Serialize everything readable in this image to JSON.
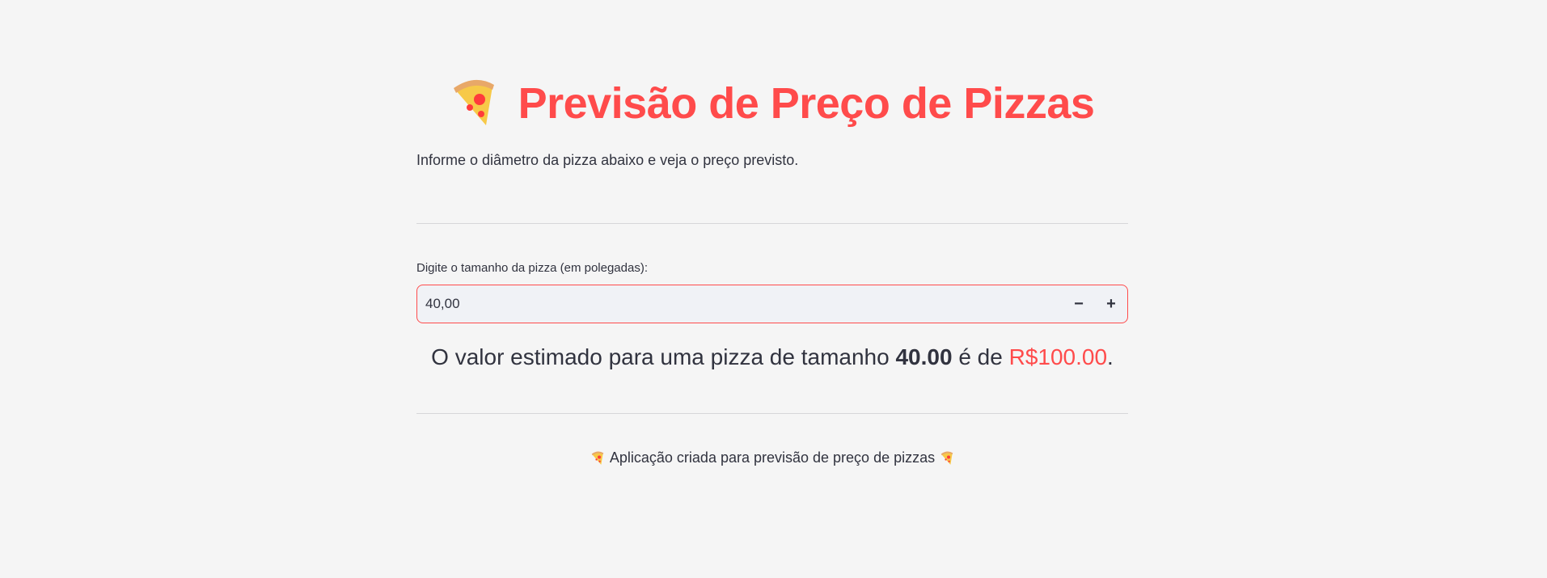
{
  "header": {
    "title": "Previsão de Preço de Pizzas",
    "title_icon": "pizza-icon",
    "subtitle": "Informe o diâmetro da pizza abaixo e veja o preço previsto."
  },
  "form": {
    "size_label": "Digite o tamanho da pizza (em polegadas):",
    "size_value": "40,00",
    "decrement_label": "−",
    "increment_label": "+"
  },
  "result": {
    "prefix": "O valor estimado para uma pizza de tamanho",
    "size": "40.00",
    "middle": "é de",
    "price": "R$100.00",
    "suffix": "."
  },
  "footer": {
    "text": "Aplicação criada para previsão de preço de pizzas",
    "icon": "pizza-icon"
  },
  "colors": {
    "accent": "#ff4b4b",
    "background": "#f5f5f5",
    "text": "#31333f",
    "input_background": "#f0f2f6"
  }
}
